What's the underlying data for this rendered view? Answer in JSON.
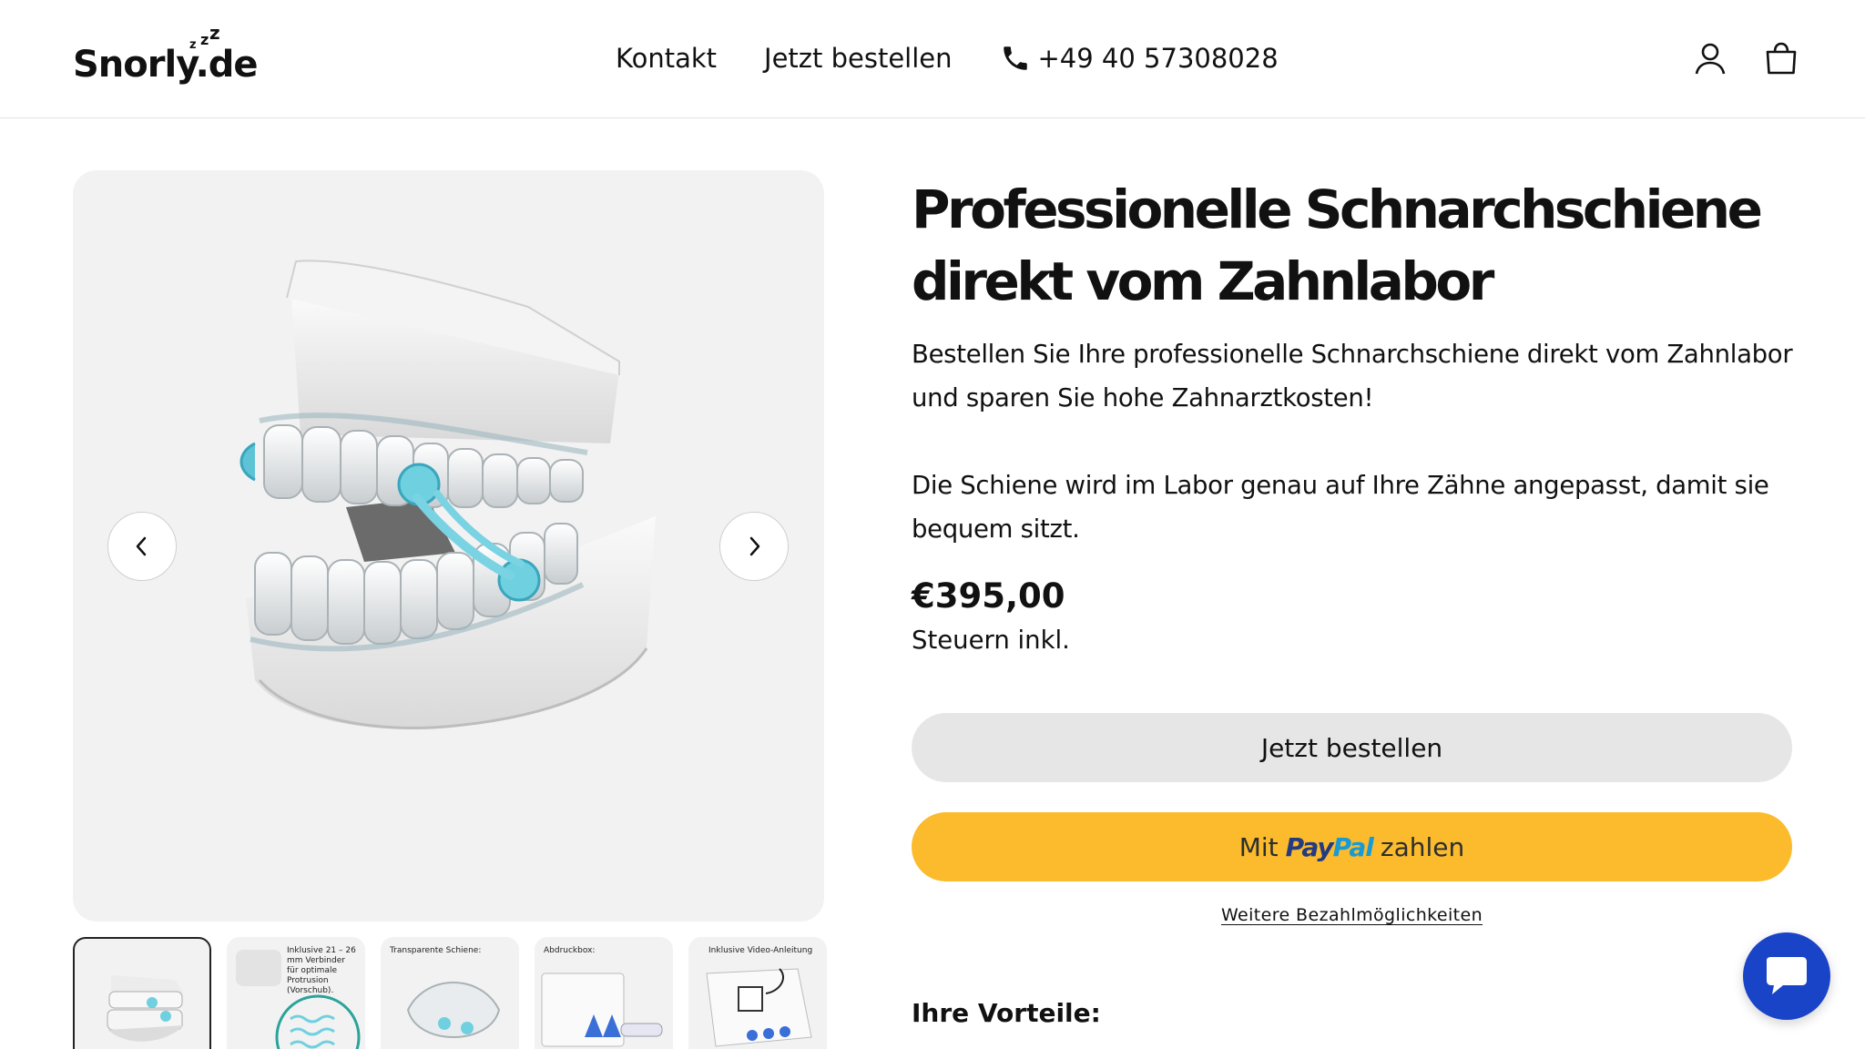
{
  "header": {
    "logo_text": "Snorly.de",
    "nav": [
      "Kontakt",
      "Jetzt bestellen"
    ],
    "phone": "+49 40 57308028"
  },
  "product": {
    "title": "Professionelle Schnarchschiene direkt vom Zahnlabor",
    "desc1": "Bestellen Sie Ihre professionelle Schnarchschiene direkt vom Zahnlabor und sparen Sie hohe Zahnarztkosten!",
    "desc2": "Die Schiene wird im Labor genau auf Ihre Zähne angepasst, damit sie bequem sitzt.",
    "price": "€395,00",
    "tax": "Steuern inkl.",
    "order_label": "Jetzt bestellen",
    "paypal_prefix": "Mit",
    "paypal_logo_pay": "Pay",
    "paypal_logo_pal": "Pal",
    "paypal_suffix": "zahlen",
    "more_payment": "Weitere Bezahlmöglichkeiten",
    "benefits_heading": "Ihre Vorteile:"
  },
  "thumbnails": [
    {
      "label": ""
    },
    {
      "label": "Inklusive 21 – 26 mm Verbinder für optimale Protrusion (Vorschub)."
    },
    {
      "label": "Transparente Schiene:"
    },
    {
      "label": "Abdruckbox:"
    },
    {
      "label": "Inklusive Video-Anleitung"
    }
  ],
  "icons": {
    "phone": "phone-icon",
    "account": "user-icon",
    "cart": "shopping-bag-icon",
    "prev": "chevron-left-icon",
    "next": "chevron-right-icon",
    "chat": "chat-icon"
  },
  "colors": {
    "paypal_button": "#fbbb2c",
    "order_button": "#e6e6e6",
    "chat_button": "#1a44c8"
  }
}
